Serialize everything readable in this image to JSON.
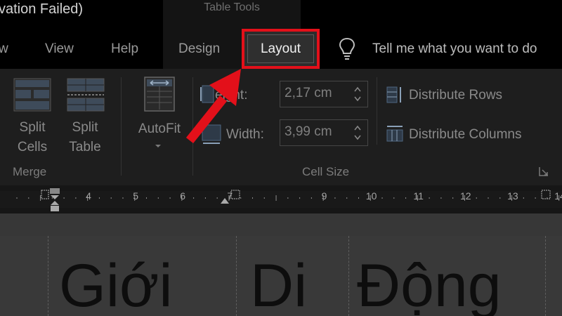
{
  "window": {
    "title": "vation Failed)",
    "context_tab_group": "Table Tools"
  },
  "tabs": [
    {
      "label": "w"
    },
    {
      "label": "View"
    },
    {
      "label": "Help"
    },
    {
      "label": "Design"
    },
    {
      "label": "Layout",
      "active": true
    }
  ],
  "tell_me": {
    "placeholder": "Tell me what you want to do"
  },
  "ribbon": {
    "merge_group": {
      "label": "Merge",
      "split_cells": [
        "Split",
        "Cells"
      ],
      "split_table": [
        "Split",
        "Table"
      ]
    },
    "autofit": {
      "label": "AutoFit"
    },
    "cell_size_group": {
      "label": "Cell Size",
      "height_label": "eight:",
      "height_value": "2,17 cm",
      "width_label": "Width:",
      "width_value": "3,99 cm",
      "distribute_rows": "Distribute Rows",
      "distribute_columns": "Distribute Columns"
    }
  },
  "ruler": {
    "numbers": [
      "4",
      "5",
      "6",
      "7",
      "8",
      "9",
      "10",
      "11",
      "12",
      "13",
      "14"
    ]
  },
  "document": {
    "cells": [
      "Giới",
      "Di",
      "Động"
    ]
  },
  "annotation": {
    "highlight_color": "#e3101a",
    "arrow_color": "#e3101a"
  }
}
